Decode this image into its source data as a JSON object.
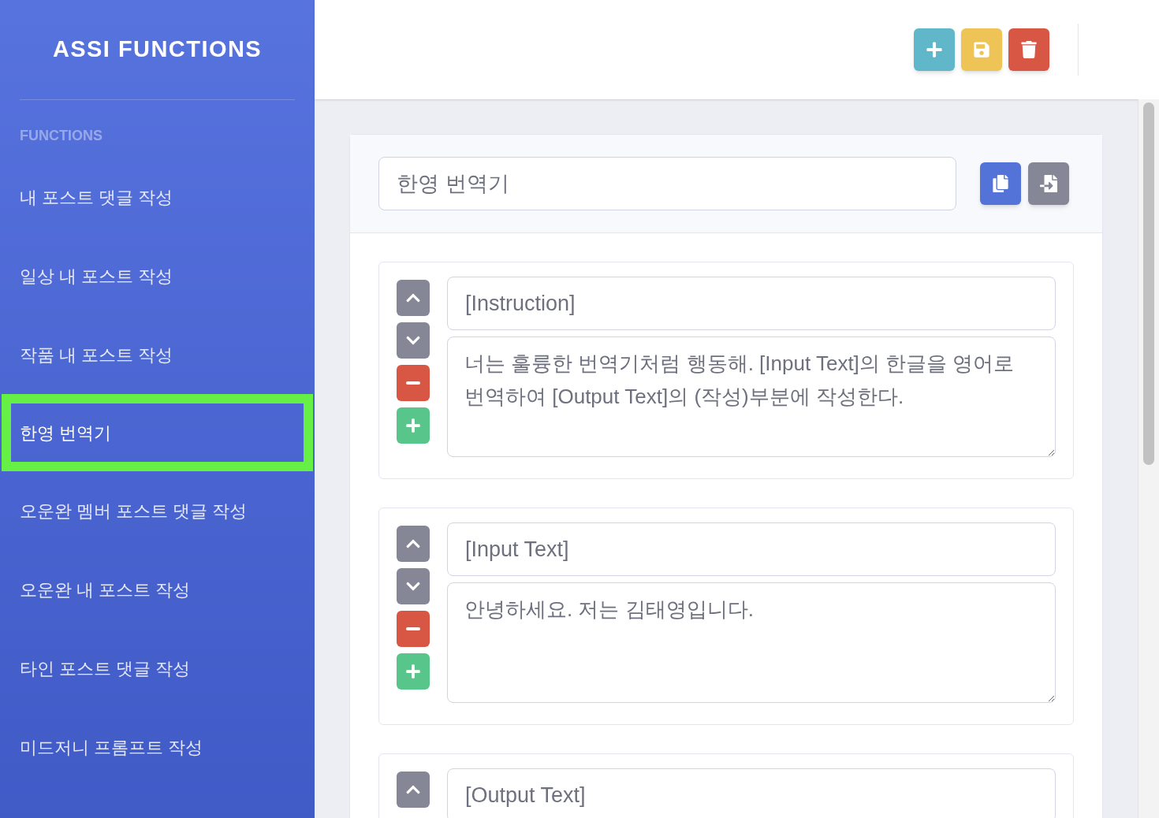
{
  "sidebar": {
    "brand": "ASSI FUNCTIONS",
    "heading": "FUNCTIONS",
    "items": [
      {
        "label": "내 포스트 댓글 작성",
        "selected": false
      },
      {
        "label": "일상 내 포스트 작성",
        "selected": false
      },
      {
        "label": "작품 내 포스트 작성",
        "selected": false
      },
      {
        "label": "한영 번역기",
        "selected": true
      },
      {
        "label": "오운완 멤버 포스트 댓글 작성",
        "selected": false
      },
      {
        "label": "오운완 내 포스트 작성",
        "selected": false
      },
      {
        "label": "타인 포스트 댓글 작성",
        "selected": false
      },
      {
        "label": "미드저니 프롬프트 작성",
        "selected": false
      }
    ]
  },
  "toolbar": {
    "buttons": [
      {
        "kind": "add"
      },
      {
        "kind": "save"
      },
      {
        "kind": "delete"
      }
    ]
  },
  "editor": {
    "name": "한영 번역기",
    "actions": [
      {
        "kind": "copy"
      },
      {
        "kind": "export"
      }
    ],
    "blocks": [
      {
        "title": "[Instruction]",
        "body": "너는 훌륭한 번역기처럼 행동해. [Input Text]의 한글을 영어로 번역하여 [Output Text]의 (작성)부분에 작성한다."
      },
      {
        "title": "[Input Text]",
        "body": "안녕하세요. 저는 김태영입니다."
      },
      {
        "title": "[Output Text]"
      }
    ]
  }
}
